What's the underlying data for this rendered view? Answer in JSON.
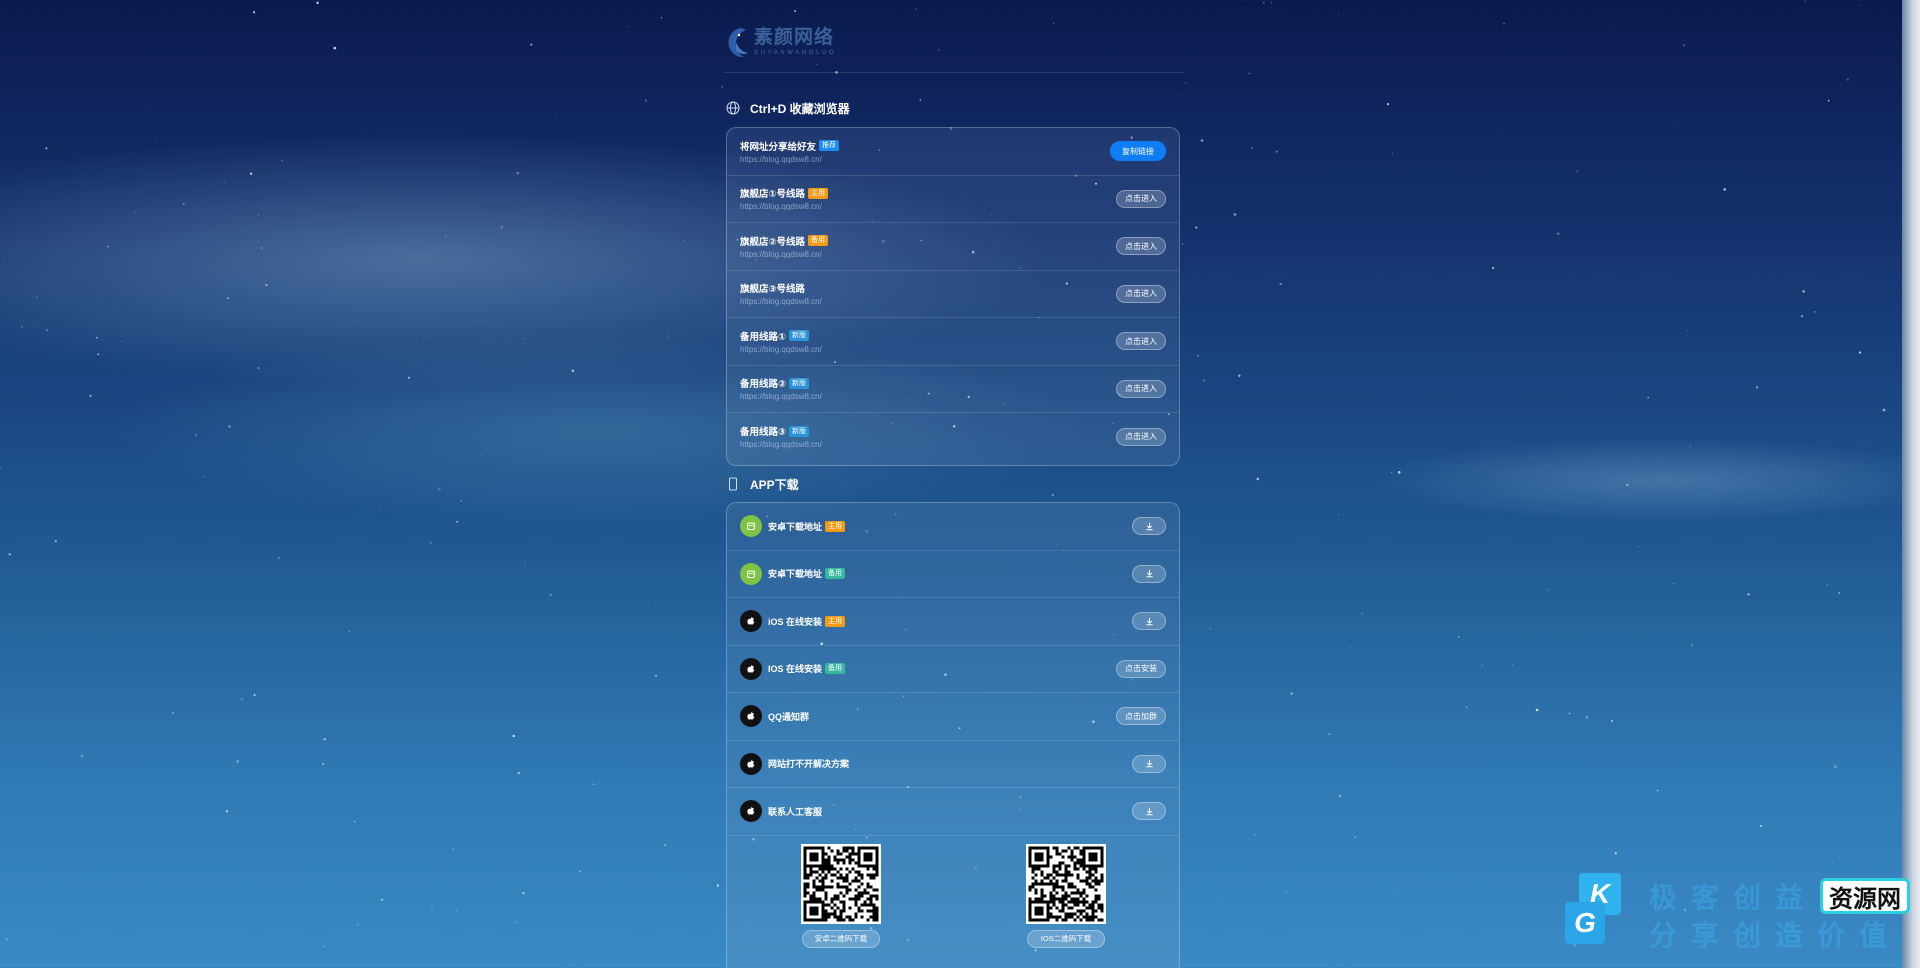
{
  "logo": {
    "title": "素颜网络",
    "subtitle": "SUYANWANGLUO"
  },
  "bookmark_section": {
    "title": "Ctrl+D 收藏浏览器",
    "icon": "globe-icon",
    "rows": [
      {
        "title": "将网址分享给好友",
        "badge": "推荐",
        "badge_color": "blue",
        "url": "https://blog.qqdsw8.cn/",
        "button": "复制链接",
        "primary": true
      },
      {
        "title": "旗舰店①号线路",
        "badge": "主用",
        "badge_color": "orange",
        "url": "https://blog.qqdsw8.cn/",
        "button": "点击进入"
      },
      {
        "title": "旗舰店②号线路",
        "badge": "备用",
        "badge_color": "orange",
        "url": "https://blog.qqdsw8.cn/",
        "button": "点击进入"
      },
      {
        "title": "旗舰店③号线路",
        "badge": "",
        "badge_color": "",
        "url": "https://blog.qqdsw8.cn/",
        "button": "点击进入"
      },
      {
        "title": "备用线路①",
        "badge": "新版",
        "badge_color": "cyan",
        "url": "https://blog.qqdsw8.cn/",
        "button": "点击进入"
      },
      {
        "title": "备用线路②",
        "badge": "新版",
        "badge_color": "cyan",
        "url": "https://blog.qqdsw8.cn/",
        "button": "点击进入"
      },
      {
        "title": "备用线路③",
        "badge": "新版",
        "badge_color": "cyan",
        "url": "https://blog.qqdsw8.cn/",
        "button": "点击进入"
      }
    ]
  },
  "app_section": {
    "title": "APP下载",
    "icon": "phone-icon",
    "rows": [
      {
        "label": "安卓下载地址",
        "badge": "主用",
        "badge_color": "orange",
        "icon": "android-icon",
        "button": "",
        "button_icon": "download-icon"
      },
      {
        "label": "安卓下载地址",
        "badge": "备用",
        "badge_color": "green",
        "icon": "android-icon",
        "button": "",
        "button_icon": "download-icon"
      },
      {
        "label": "iOS 在线安装",
        "badge": "主用",
        "badge_color": "orange",
        "icon": "apple-icon",
        "button": "",
        "button_icon": "download-icon"
      },
      {
        "label": "IOS 在线安装",
        "badge": "备用",
        "badge_color": "green",
        "icon": "apple-icon",
        "button": "点击安装",
        "button_icon": ""
      },
      {
        "label": "QQ通知群",
        "badge": "",
        "badge_color": "",
        "icon": "apple-icon",
        "button": "点击加群",
        "button_icon": ""
      },
      {
        "label": "网站打不开解决方案",
        "badge": "",
        "badge_color": "",
        "icon": "apple-icon",
        "button": "",
        "button_icon": "download-icon"
      },
      {
        "label": "联系人工客服",
        "badge": "",
        "badge_color": "",
        "icon": "apple-icon",
        "button": "",
        "button_icon": "download-icon"
      }
    ],
    "qr": [
      {
        "label": "安卓二维码下载"
      },
      {
        "label": "IOS二维码下载"
      }
    ]
  },
  "watermark": {
    "k": "K",
    "g": "G",
    "line1": "极客创益",
    "line2": "分享创造价值",
    "badge": "资源网"
  }
}
